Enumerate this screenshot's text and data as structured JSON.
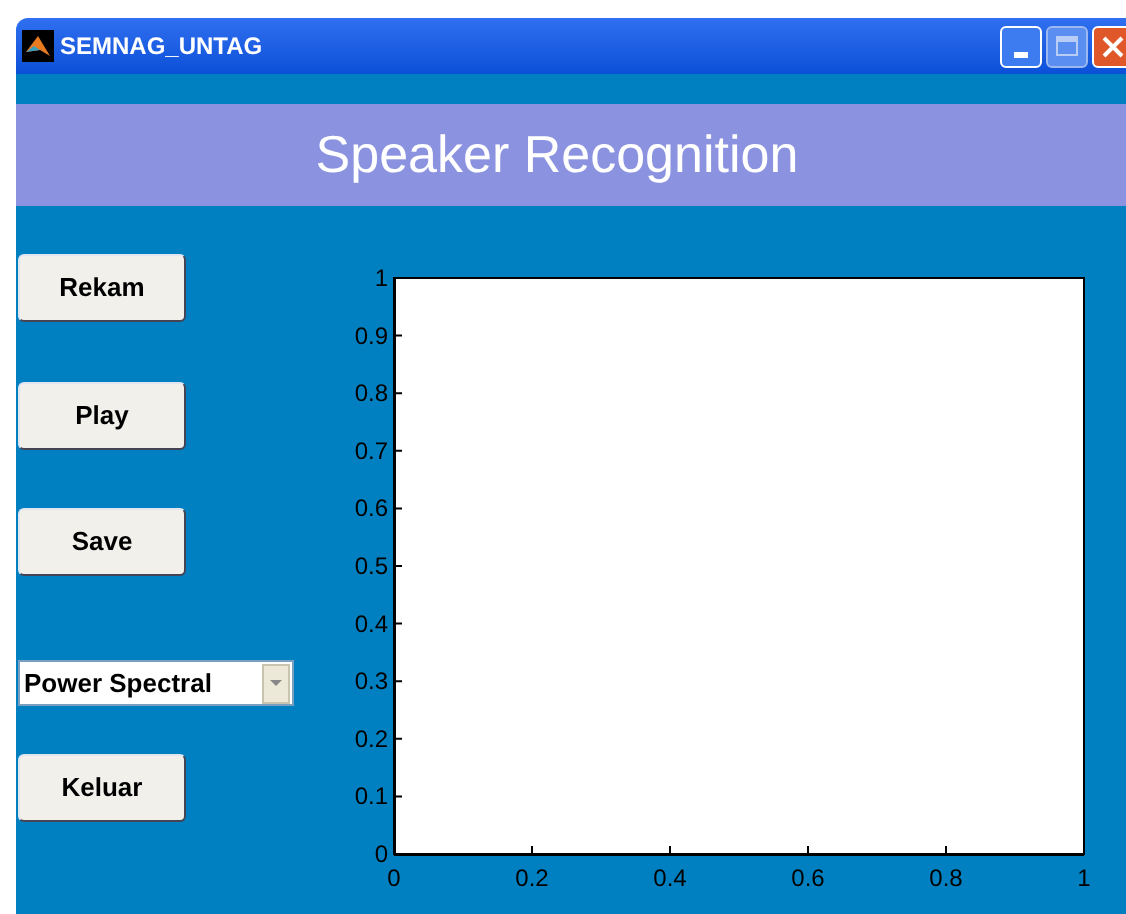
{
  "window": {
    "title": "SEMNAG_UNTAG"
  },
  "header": {
    "title": "Speaker Recognition"
  },
  "buttons": [
    "Rekam",
    "Play",
    "Save"
  ],
  "dropdown": {
    "value": "Power Spectral"
  },
  "exit_button": "Keluar",
  "plot": {
    "chart_data": {
      "type": "line",
      "xlim": [
        0,
        1
      ],
      "ylim": [
        0,
        1
      ],
      "xticks": [
        0,
        0.2,
        0.4,
        0.6,
        0.8,
        1
      ],
      "yticks": [
        0,
        0.1,
        0.2,
        0.3,
        0.4,
        0.5,
        0.6,
        0.7,
        0.8,
        0.9,
        1
      ]
    }
  }
}
